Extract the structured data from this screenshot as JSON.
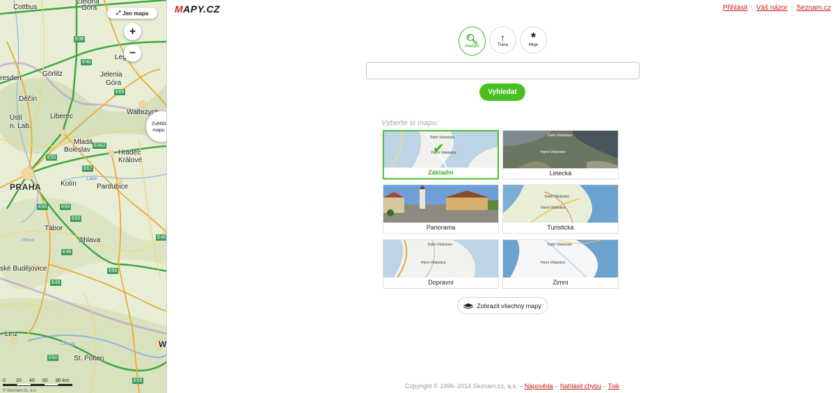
{
  "map": {
    "jen_mapa": "Jen mapa",
    "zoom_in": "+",
    "zoom_out": "−",
    "expand_line1": "Zvětšit",
    "expand_line2": "mapu",
    "scale_ticks": [
      "0",
      "20",
      "40",
      "60",
      "80 km"
    ],
    "copyright": "© Seznam.cz, a.s.",
    "cities": [
      "Cottbus",
      "Zielona",
      "Góra",
      "Legn",
      "Görlitz",
      "Jelenia",
      "Góra",
      "resden",
      "Děčín",
      "Liberec",
      "Walbrzych",
      "Ústí",
      "n. Lab.",
      "Mladá",
      "Boleslav",
      "Hradec",
      "Králové",
      "PRAHA",
      "Kolín",
      "Pardubice",
      "Tábor",
      "Jihlava",
      "ské Budějovice",
      "Linz",
      "St. Pölten",
      "W",
      "Donau",
      "Labe",
      "Vltava"
    ],
    "roads": [
      "E36",
      "E40",
      "E65",
      "E442",
      "E55",
      "E67",
      "E65",
      "E50",
      "E55",
      "E59",
      "E49",
      "E461",
      "E60",
      "E49",
      "E59",
      "E49",
      "E50",
      "E461",
      "E56",
      "E60",
      "E59"
    ]
  },
  "header": {
    "logo": "MAPY.CZ",
    "links": [
      "Přihlásit",
      "Váš názor",
      "Seznam.cz"
    ]
  },
  "modes": [
    {
      "icon": "search-icon",
      "label": "Hledání",
      "active": true
    },
    {
      "icon": "arrow-up-icon",
      "label": "Trasa",
      "active": false
    },
    {
      "icon": "star-icon",
      "label": "Moje",
      "active": false
    }
  ],
  "search": {
    "value": "",
    "placeholder": "",
    "button": "Vyhledat"
  },
  "map_chooser": {
    "label": "Vyberte si mapu:",
    "cards": [
      {
        "name": "Základní",
        "selected": true,
        "thumb_labels": [
          "Dolní Věstonice",
          "Horní Věstonice"
        ]
      },
      {
        "name": "Letecká",
        "selected": false,
        "thumb_labels": [
          "Dolní Věstonice",
          "Horní Věstonice"
        ]
      },
      {
        "name": "Panorama",
        "selected": false,
        "thumb_labels": []
      },
      {
        "name": "Turistická",
        "selected": false,
        "thumb_labels": [
          "Dolní Věstonice",
          "Horní Věstonice"
        ]
      },
      {
        "name": "Dopravní",
        "selected": false,
        "thumb_labels": [
          "Dolní Věstonice",
          "Horní Věstonice"
        ]
      },
      {
        "name": "Zimní",
        "selected": false,
        "thumb_labels": [
          "Dolní Věstonice",
          "Horní Věstonice"
        ]
      }
    ],
    "all_maps": "Zobrazit všechny mapy"
  },
  "footer": {
    "copyright": "Copyright © 1996–2014 Seznam.cz, a.s.",
    "links": [
      "Nápověda",
      "Nahlásit chybu",
      "Tisk"
    ],
    "separator": "–"
  }
}
